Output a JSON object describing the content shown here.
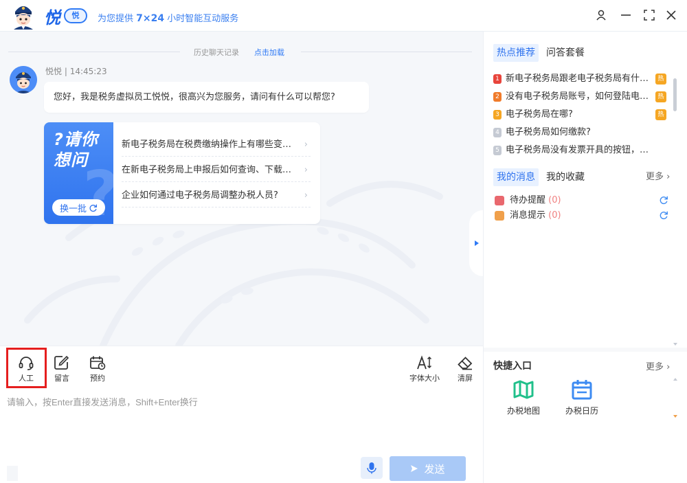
{
  "header": {
    "brand": "悦",
    "brand_badge": "悦",
    "slogan_prefix": "为您提供 ",
    "slogan_highlight": "7×24",
    "slogan_suffix": " 小时智能互动服务"
  },
  "chat": {
    "history_text": "历史聊天记录",
    "history_link": "点击加载",
    "sender": "悦悦",
    "separator": " | ",
    "time": "14:45:23",
    "greeting": "您好，我是税务虚拟员工悦悦，很高兴为您服务，请问有什么可以帮您?",
    "ask_title": "?请你想问",
    "swap_label": "换一批",
    "ask_items": [
      {
        "text": "新电子税务局在税费缴纳操作上有哪些变化?"
      },
      {
        "text": "在新电子税务局上申报后如何查询、下载申报表?"
      },
      {
        "text": "企业如何通过电子税务局调整办税人员?"
      }
    ]
  },
  "toolbar": {
    "manual": "人工",
    "message": "留言",
    "reserve": "预约",
    "font_size": "字体大小",
    "clear": "清屏"
  },
  "input": {
    "placeholder": "请输入，按Enter直接发送消息，Shift+Enter换行",
    "send_label": "发送"
  },
  "right": {
    "tab_hot": "热点推荐",
    "tab_qa": "问答套餐",
    "hot_items": [
      {
        "num": "1",
        "text": "新电子税务局跟老电子税务局有什么区别?",
        "badge": "热",
        "color": "#e8453c"
      },
      {
        "num": "2",
        "text": "没有电子税务局账号，如何登陆电子税务局?",
        "badge": "热",
        "color": "#f07b2b"
      },
      {
        "num": "3",
        "text": "电子税务局在哪?",
        "badge": "热",
        "color": "#f5a623"
      },
      {
        "num": "4",
        "text": "电子税务局如何缴款?",
        "badge": "",
        "color": "#c5cad3"
      },
      {
        "num": "5",
        "text": "电子税务局没有发票开具的按钮，是什么原因?",
        "badge": "",
        "color": "#c5cad3"
      }
    ],
    "tab_msg": "我的消息",
    "tab_fav": "我的收藏",
    "more": "更多",
    "msgs": [
      {
        "label": "待办提醒",
        "count": "(0)",
        "color": "#e9686e"
      },
      {
        "label": "消息提示",
        "count": "(0)",
        "color": "#f0a04b"
      }
    ],
    "quick_title": "快捷入口",
    "quick_more": "更多",
    "quick_items": [
      {
        "label": "办税地图",
        "color": "#21c08b"
      },
      {
        "label": "办税日历",
        "color": "#3d8bf2"
      }
    ]
  }
}
